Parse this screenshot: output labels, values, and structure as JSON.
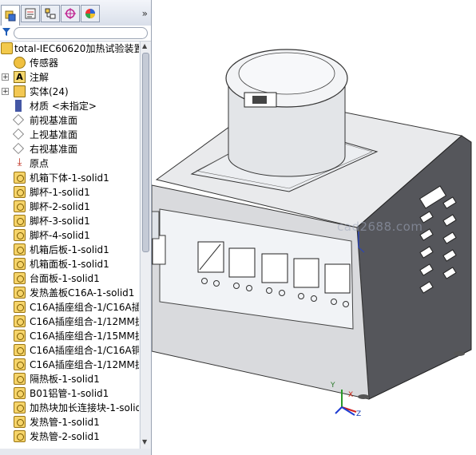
{
  "colors": {
    "panel_bg": "#f4f6f9",
    "tree_bg": "#ffffff",
    "body_gray": "#d9dadd",
    "panel_front": "#f0f2f5",
    "dark_side": "#4a4a4f",
    "accent_blue": "#1f5db8"
  },
  "tabs": [
    {
      "name": "feature-manager-tab",
      "icon": "feature-tree-icon",
      "active": true
    },
    {
      "name": "property-manager-tab",
      "icon": "property-icon",
      "active": false
    },
    {
      "name": "configuration-manager-tab",
      "icon": "configuration-icon",
      "active": false
    },
    {
      "name": "dimxpert-tab",
      "icon": "crosshair-icon",
      "active": false
    },
    {
      "name": "display-manager-tab",
      "icon": "appearance-icon",
      "active": false
    }
  ],
  "tab_overflow": "»",
  "filter_icon": "funnel-icon",
  "tree": {
    "root": "total-IEC60620加热试验装置",
    "items": [
      {
        "label": "传感器",
        "icon": "sensor-icon",
        "expander": ""
      },
      {
        "label": "注解",
        "icon": "annotation-icon",
        "expander": "+"
      },
      {
        "label": "实体(24)",
        "icon": "solid-bodies-icon",
        "expander": "+"
      },
      {
        "label": "材质 <未指定>",
        "icon": "material-icon",
        "expander": ""
      },
      {
        "label": "前视基准面",
        "icon": "plane-icon",
        "expander": ""
      },
      {
        "label": "上视基准面",
        "icon": "plane-icon",
        "expander": ""
      },
      {
        "label": "右视基准面",
        "icon": "plane-icon",
        "expander": ""
      },
      {
        "label": "原点",
        "icon": "origin-icon",
        "expander": ""
      },
      {
        "label": "机箱下体-1-solid1",
        "icon": "component-icon",
        "expander": ""
      },
      {
        "label": "脚杯-1-solid1",
        "icon": "component-icon",
        "expander": ""
      },
      {
        "label": "脚杯-2-solid1",
        "icon": "component-icon",
        "expander": ""
      },
      {
        "label": "脚杯-3-solid1",
        "icon": "component-icon",
        "expander": ""
      },
      {
        "label": "脚杯-4-solid1",
        "icon": "component-icon",
        "expander": ""
      },
      {
        "label": "机箱后板-1-solid1",
        "icon": "component-icon",
        "expander": ""
      },
      {
        "label": "机箱面板-1-solid1",
        "icon": "component-icon",
        "expander": ""
      },
      {
        "label": "台面板-1-solid1",
        "icon": "component-icon",
        "expander": ""
      },
      {
        "label": "发热盖板C16A-1-solid1",
        "icon": "component-icon",
        "expander": ""
      },
      {
        "label": "C16A插座组合-1/C16A插",
        "icon": "component-icon",
        "expander": ""
      },
      {
        "label": "C16A插座组合-1/12MM执",
        "icon": "component-icon",
        "expander": ""
      },
      {
        "label": "C16A插座组合-1/15MM执",
        "icon": "component-icon",
        "expander": ""
      },
      {
        "label": "C16A插座组合-1/C16A铜",
        "icon": "component-icon",
        "expander": ""
      },
      {
        "label": "C16A插座组合-1/12MM执",
        "icon": "component-icon",
        "expander": ""
      },
      {
        "label": "隔热板-1-solid1",
        "icon": "component-icon",
        "expander": ""
      },
      {
        "label": "B01铝管-1-solid1",
        "icon": "component-icon",
        "expander": ""
      },
      {
        "label": "加热块加长连接块-1-solid",
        "icon": "component-icon",
        "expander": ""
      },
      {
        "label": "发热管-1-solid1",
        "icon": "component-icon",
        "expander": ""
      },
      {
        "label": "发热管-2-solid1",
        "icon": "component-icon",
        "expander": ""
      }
    ]
  },
  "viewport": {
    "watermark": "cad2688.com",
    "triad": {
      "x": "X",
      "y": "Y",
      "z": "Z"
    },
    "panel_displays": 5,
    "vent_slots": 10
  }
}
